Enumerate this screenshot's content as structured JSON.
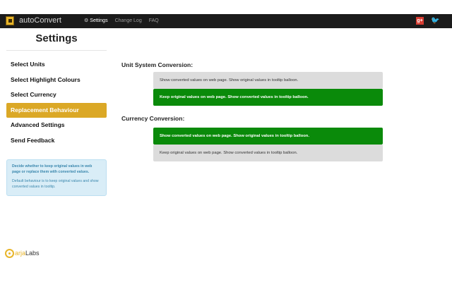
{
  "app": {
    "title": "autoConvert"
  },
  "nav": {
    "items": [
      {
        "label": "Settings",
        "active": true,
        "icon": "gear-icon"
      },
      {
        "label": "Change Log",
        "active": false
      },
      {
        "label": "FAQ",
        "active": false
      }
    ]
  },
  "social": {
    "gplus_label": "g+",
    "icons": [
      "google-plus-icon",
      "twitter-icon"
    ]
  },
  "sidebar": {
    "title": "Settings",
    "items": [
      {
        "label": "Select Units"
      },
      {
        "label": "Select Highlight Colours"
      },
      {
        "label": "Select Currency"
      },
      {
        "label": "Replacement Behaviour",
        "active": true
      },
      {
        "label": "Advanced Settings"
      },
      {
        "label": "Send Feedback"
      }
    ],
    "help": {
      "strong": "Decide whether to keep original values in web page or replace them with converted values.",
      "note": "Default behaviour is to keep original values and show converted values in tooltip."
    }
  },
  "main": {
    "unit_section": {
      "title": "Unit System Conversion:",
      "options": [
        {
          "label": "Show converted values on web page. Show original values in tooltip balloon.",
          "selected": false
        },
        {
          "label": "Keep original values on web page. Show converted values in tooltip balloon.",
          "selected": true
        }
      ]
    },
    "currency_section": {
      "title": "Currency Conversion:",
      "options": [
        {
          "label": "Show converted values on web page. Show original values in tooltip balloon.",
          "selected": true
        },
        {
          "label": "Keep original values on web page. Show converted values in tooltip balloon.",
          "selected": false
        }
      ]
    }
  },
  "footer": {
    "logo_a": "arja",
    "logo_b": "Labs"
  },
  "colors": {
    "accent": "#dba826",
    "selected": "#0a8a0a",
    "unselected": "#dcdcdc",
    "topbar": "#1b1b1b",
    "help_bg": "#d9edf7"
  }
}
